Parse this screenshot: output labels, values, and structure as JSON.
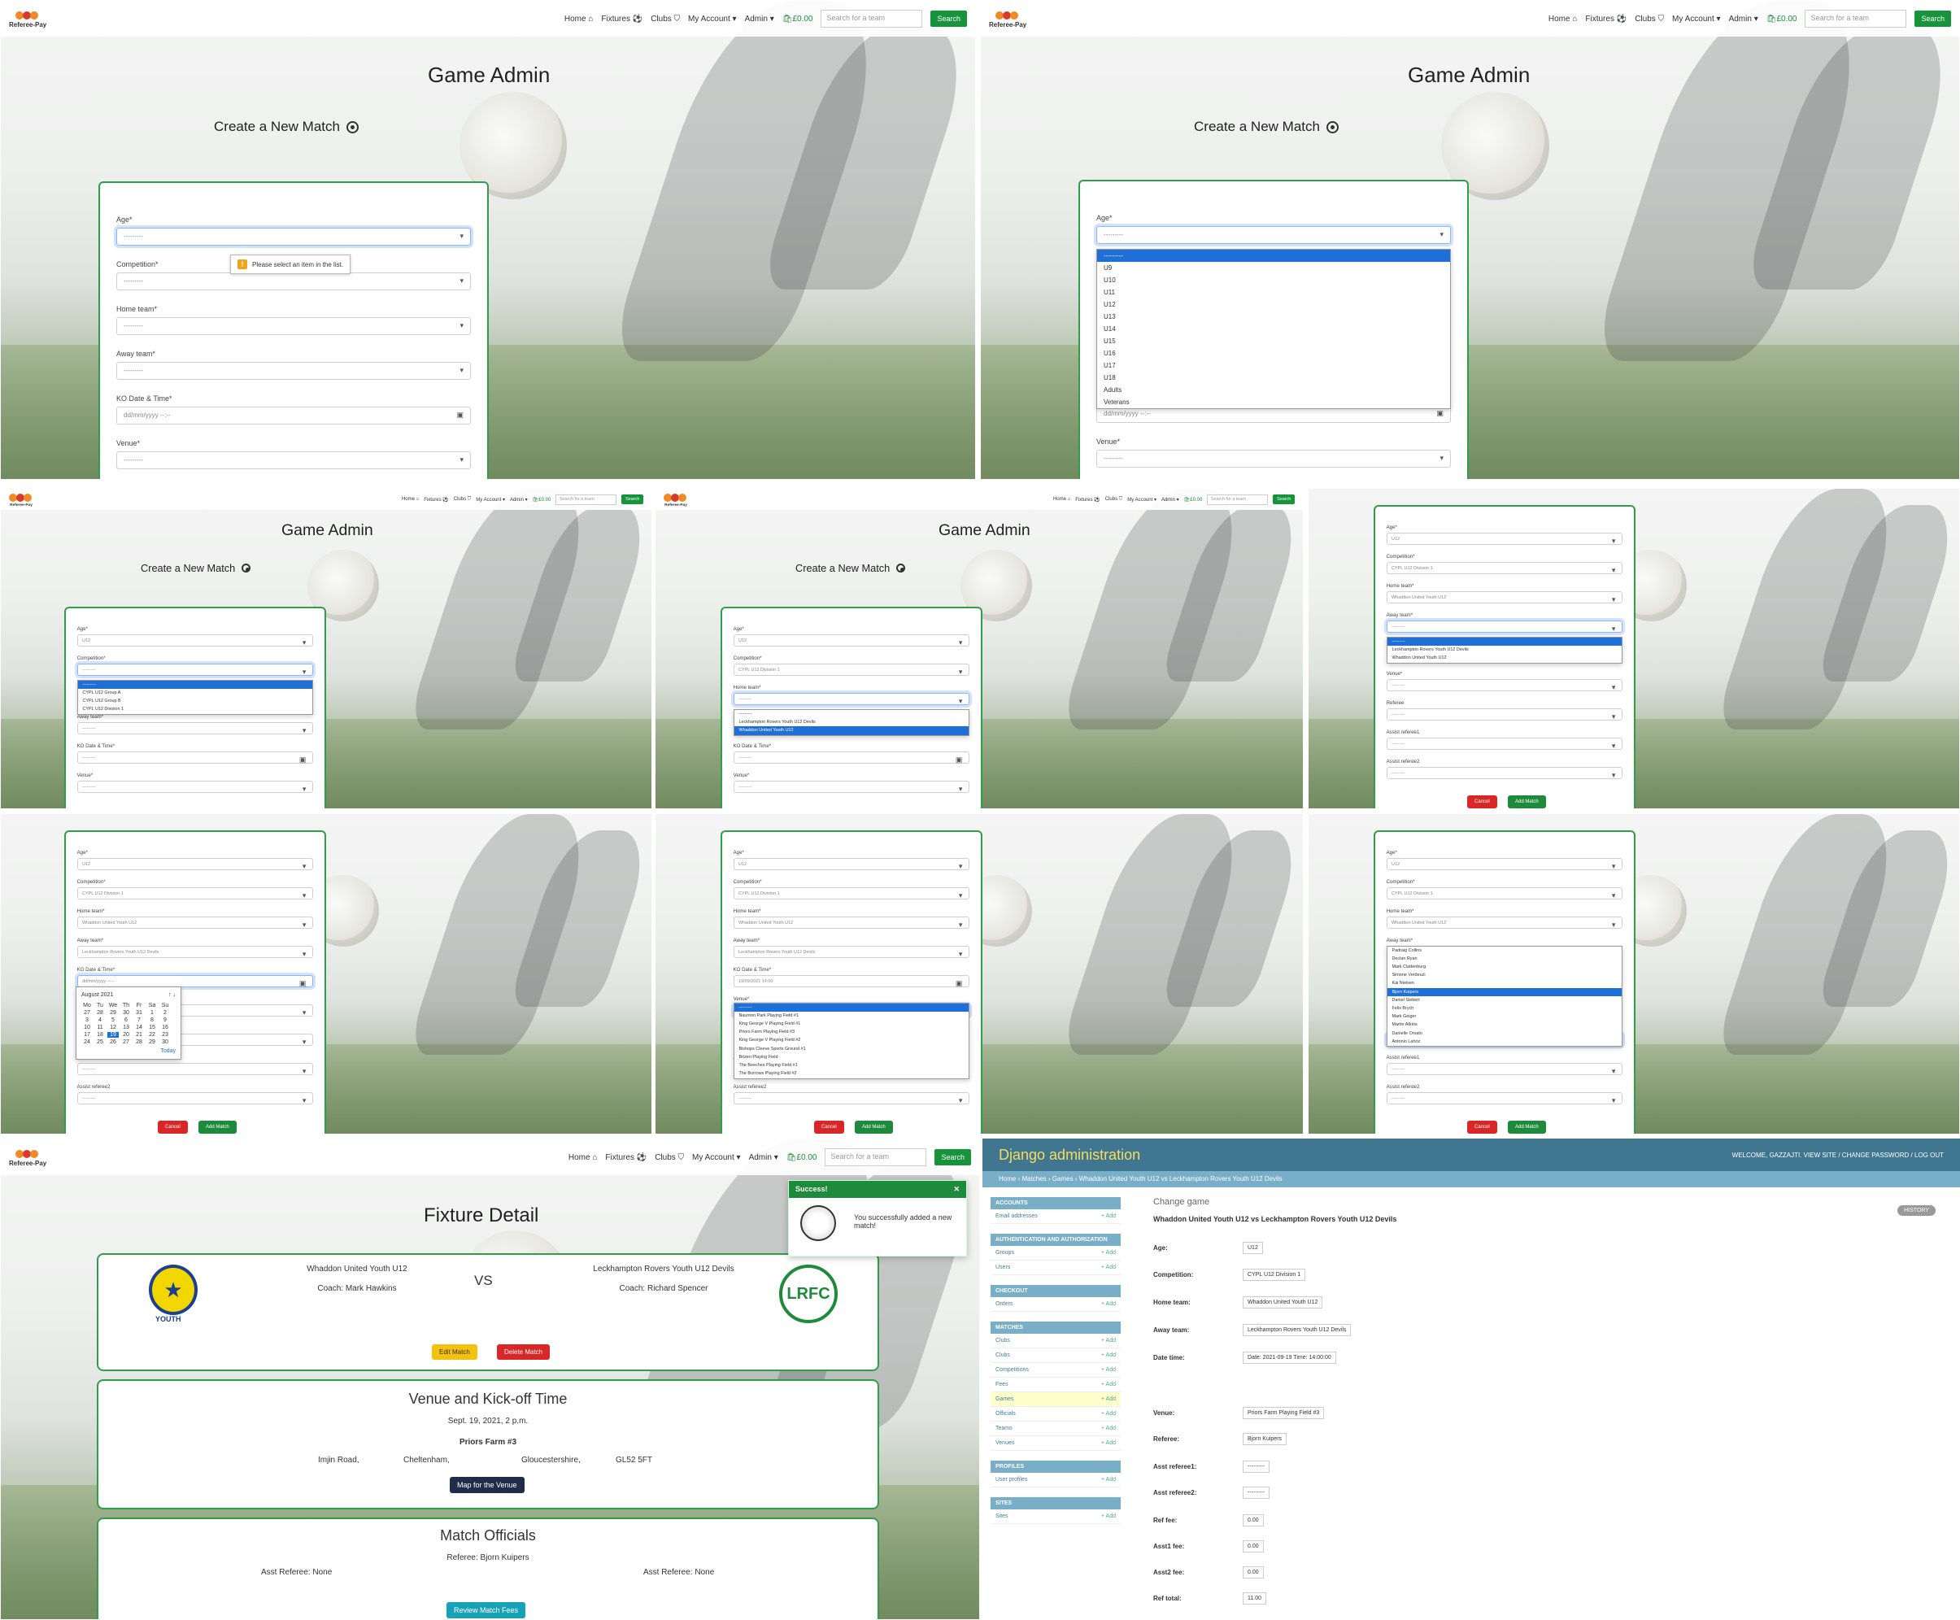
{
  "nav": {
    "logo": "Referee-Pay",
    "home": "Home",
    "fixtures": "Fixtures",
    "clubs": "Clubs",
    "account": "My Account",
    "admin": "Admin",
    "basket": "£0.00",
    "search_placeholder": "Search for a team",
    "search_button": "Search"
  },
  "admin_page": {
    "title": "Game Admin",
    "subtitle": "Create a New Match"
  },
  "form": {
    "age_label": "Age*",
    "competition_label": "Competition*",
    "home_label": "Home team*",
    "away_label": "Away team*",
    "ko_label": "KO Date & Time*",
    "venue_label": "Venue*",
    "referee_label": "Referee",
    "assist1_label": "Assist referee1",
    "assist2_label": "Assist referee2",
    "empty": "---------",
    "date_placeholder": "dd/mm/yyyy --:--",
    "tooltip": "Please select an item in the list.",
    "cancel": "Cancel",
    "add": "Add Match",
    "age_value": "U12",
    "competition_value": "CYPL U12 Division 1",
    "home_value": "Whaddon United Youth U12",
    "away_value": "Leckhampton Rovers Youth U12 Devils",
    "ko_value": "19/09/2021 14:00",
    "referee_value": "Bjorn Kuipers"
  },
  "age_options": [
    "---------",
    "U9",
    "U10",
    "U11",
    "U12",
    "U13",
    "U14",
    "U15",
    "U16",
    "U17",
    "U18",
    "Adults",
    "Veterans"
  ],
  "competition_options": [
    "---------",
    "CYPL U12 Group A",
    "CYPL U12 Group B",
    "CYPL U12 Division 1"
  ],
  "home_options": [
    "---------",
    "Leckhampton Rovers Youth U12 Devils",
    "Whaddon United Youth U12"
  ],
  "away_options": [
    "---------",
    "Leckhampton Rovers Youth U12 Devils",
    "Whaddon United Youth U12"
  ],
  "venue_options": [
    "---------",
    "Naunton Park Playing Field #1",
    "King George V Playing Field #1",
    "Priors Farm Playing Field #3",
    "King George V Playing Field #2",
    "Bishops Cleeve Sports Ground #1",
    "Brizen Playing Field",
    "The Beeches Playing Field #1",
    "The Burrows Playing Field #2"
  ],
  "referee_options": [
    "Padraig Collins",
    "Declan Ryan",
    "Mark Clattenburg",
    "Simone Verdeuzi",
    "Kai Nielsen",
    "Bjorn Kuipers",
    "Daniel Siebert",
    "Felix Brych",
    "Mark Geiger",
    "Martin Atkins",
    "Danielle Orsato",
    "Antonio Lahoz"
  ],
  "calendar": {
    "month": "August 2021",
    "days": [
      "Mo",
      "Tu",
      "We",
      "Th",
      "Fr",
      "Sa",
      "Su"
    ],
    "today": "Today"
  },
  "fixture": {
    "title": "Fixture Detail",
    "home_team": "Whaddon United Youth U12",
    "home_coach": "Coach: Mark Hawkins",
    "vs": "VS",
    "away_team": "Leckhampton Rovers Youth U12 Devils",
    "away_coach": "Coach: Richard Spencer",
    "home_badge_text": "YOUTH",
    "away_badge_text": "LRFC",
    "edit": "Edit Match",
    "delete": "Delete Match",
    "venue_title": "Venue and Kick-off Time",
    "datetime": "Sept. 19, 2021, 2 p.m.",
    "venue_name": "Priors Farm #3",
    "address_1": "Imjin Road,",
    "address_2": "Cheltenham,",
    "address_3": "Gloucestershire,",
    "postcode": "GL52 5FT",
    "map_button": "Map for the Venue",
    "officials_title": "Match Officials",
    "referee": "Referee: Bjorn Kuipers",
    "assist1": "Asst Referee: None",
    "assist2": "Asst Referee: None",
    "fees_button": "Review Match Fees",
    "toast_head": "Success!",
    "toast_msg": "You successfully added a new match!"
  },
  "django": {
    "brand": "Django administration",
    "user": "WELCOME, GAZZAJTI. VIEW SITE / CHANGE PASSWORD / LOG OUT",
    "crumbs": "Home › Matches › Games › Whaddon United Youth U12 vs Leckhampton Rovers Youth U12 Devils",
    "change": "Change game",
    "history": "HISTORY",
    "heading": "Whaddon United Youth U12 vs Leckhampton Rovers Youth U12 Devils",
    "modules": [
      {
        "name": "ACCOUNTS",
        "rows": [
          "Email addresses"
        ]
      },
      {
        "name": "AUTHENTICATION AND AUTHORIZATION",
        "rows": [
          "Groups",
          "Users"
        ]
      },
      {
        "name": "CHECKOUT",
        "rows": [
          "Orders"
        ]
      },
      {
        "name": "MATCHES",
        "rows": [
          "Clubs",
          "Clubs",
          "Competitions",
          "Fees",
          "Games",
          "Officials",
          "Teams",
          "Venues"
        ]
      },
      {
        "name": "PROFILES",
        "rows": [
          "User profiles"
        ]
      },
      {
        "name": "SITES",
        "rows": [
          "Sites"
        ]
      }
    ],
    "add": "+ Add",
    "fields": [
      {
        "label": "Age:",
        "value": "U12"
      },
      {
        "label": "Competition:",
        "value": "CYPL U12 Division 1"
      },
      {
        "label": "Home team:",
        "value": "Whaddon United Youth U12"
      },
      {
        "label": "Away team:",
        "value": "Leckhampton Rovers Youth U12 Devils"
      },
      {
        "label": "Date time:",
        "value": "Date: 2021-09-19  Time: 14:00:00"
      },
      {
        "label": "Venue:",
        "value": "Priors Farm Playing Field #3"
      },
      {
        "label": "Referee:",
        "value": "Bjorn Kuipers"
      },
      {
        "label": "Asst referee1:",
        "value": "---------"
      },
      {
        "label": "Asst referee2:",
        "value": "---------"
      },
      {
        "label": "Ref fee:",
        "value": "0.00"
      },
      {
        "label": "Asst1 fee:",
        "value": "0.00"
      },
      {
        "label": "Asst2 fee:",
        "value": "0.00"
      },
      {
        "label": "Ref total:",
        "value": "11.00"
      }
    ]
  }
}
